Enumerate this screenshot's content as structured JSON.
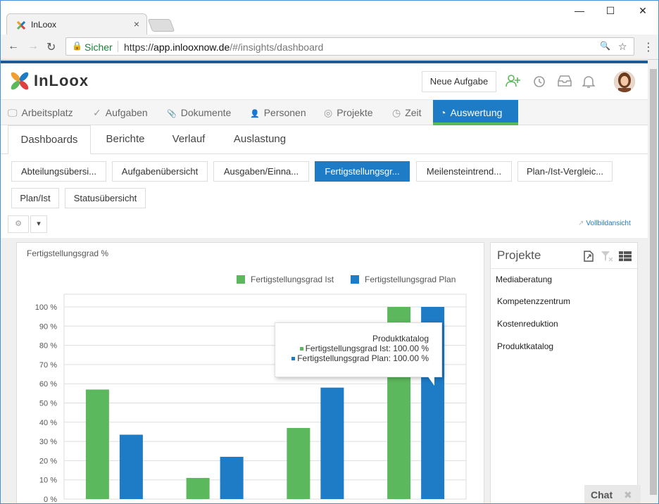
{
  "browser": {
    "tab_title": "InLoox",
    "tab_close": "×",
    "window_controls": {
      "minimize": "—",
      "maximize": "☐",
      "close": "✕"
    },
    "nav": {
      "back": "←",
      "forward": "→",
      "reload": "↻"
    },
    "security_label": "Sicher",
    "url_scheme": "https://",
    "url_domain": "app.inlooxnow.de",
    "url_path": "/#/insights/dashboard",
    "search_glyph": "🔍",
    "star_glyph": "☆",
    "menu_glyph": "⋮"
  },
  "header": {
    "logo_text": "InLoox",
    "new_task_label": "Neue Aufgabe"
  },
  "main_nav": [
    {
      "label": "Arbeitsplatz",
      "icon": "monitor-icon",
      "glyph": "🖵"
    },
    {
      "label": "Aufgaben",
      "icon": "check-icon",
      "glyph": "✓"
    },
    {
      "label": "Dokumente",
      "icon": "paperclip-icon",
      "glyph": "📎"
    },
    {
      "label": "Personen",
      "icon": "person-icon",
      "glyph": "👤"
    },
    {
      "label": "Projekte",
      "icon": "target-icon",
      "glyph": "◎"
    },
    {
      "label": "Zeit",
      "icon": "clock-icon",
      "glyph": "◷"
    },
    {
      "label": "Auswertung",
      "icon": "pie-chart-icon",
      "glyph": "◔",
      "active": true
    }
  ],
  "sub_tabs": [
    "Dashboards",
    "Berichte",
    "Verlauf",
    "Auslastung"
  ],
  "dashboards": [
    "Abteilungsübersi...",
    "Aufgabenübersicht",
    "Ausgaben/Einna...",
    "Fertigstellungsgr...",
    "Meilensteintrend...",
    "Plan-/Ist-Vergleic...",
    "Plan/Ist",
    "Statusübersicht"
  ],
  "selected_dashboard": "Fertigstellungsgr...",
  "settings_glyph": "⚙",
  "dropdown_glyph": "▾",
  "fullscreen_label": "Vollbildansicht",
  "chart_panel_title": "Fertigstellungsgrad %",
  "chart_data": {
    "type": "bar",
    "title": "Fertigstellungsgrad %",
    "categories": [
      "Mediaberatung",
      "Kompetenzzentrum",
      "Kostenreduktion",
      "Produktkatalog"
    ],
    "series": [
      {
        "name": "Fertigstellungsgrad Ist",
        "color": "#5cb85c",
        "values": [
          57,
          11,
          37,
          100
        ]
      },
      {
        "name": "Fertigstellungsgrad Plan",
        "color": "#1e7bc5",
        "values": [
          33.5,
          22,
          58,
          100
        ]
      }
    ],
    "ylim": [
      0,
      100
    ],
    "yticks": [
      "0 %",
      "10 %",
      "20 %",
      "30 %",
      "40 %",
      "50 %",
      "60 %",
      "70 %",
      "80 %",
      "90 %",
      "100 %"
    ],
    "legend": "top-right",
    "grid": true
  },
  "tooltip": {
    "title": "Produktkatalog",
    "line1": "Fertigstellungsgrad Ist: 100.00 %",
    "line2": "Fertigstellungsgrad Plan: 100.00 %"
  },
  "projects_panel": {
    "title": "Projekte",
    "items": [
      "Mediaberatung",
      "Kompetenzzentrum",
      "Kostenreduktion",
      "Produktkatalog"
    ]
  },
  "chat": {
    "label": "Chat",
    "close": "✖"
  }
}
